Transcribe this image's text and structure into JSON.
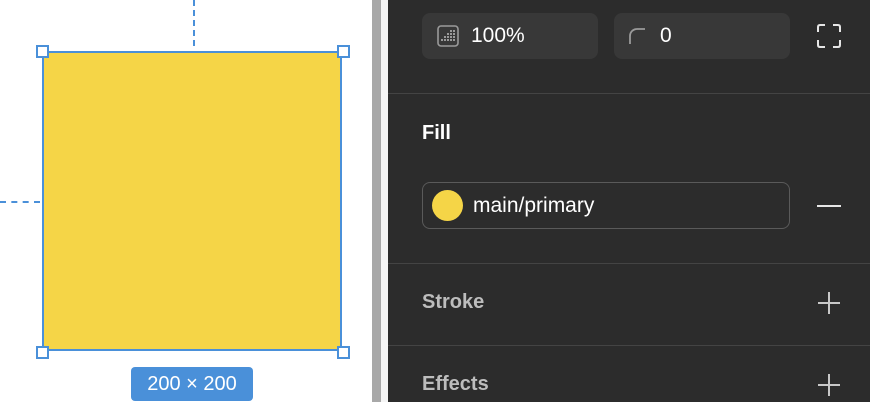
{
  "colors": {
    "selection": "#4a90d9",
    "shape_fill": "#f5d547",
    "panel_bg": "#2c2c2c",
    "field_bg": "#383838"
  },
  "canvas": {
    "size_label": "200 × 200"
  },
  "properties": {
    "opacity": {
      "icon": "opacity-icon",
      "value": "100%"
    },
    "corner_radius": {
      "icon": "corner-radius-icon",
      "value": "0"
    },
    "expand_icon": "expand-corners-icon"
  },
  "fill": {
    "title": "Fill",
    "items": [
      {
        "swatch_color": "#f5d547",
        "name": "main/primary",
        "remove_icon": "minus-icon"
      }
    ]
  },
  "stroke": {
    "title": "Stroke",
    "add_icon": "plus-icon"
  },
  "effects": {
    "title": "Effects",
    "add_icon": "plus-icon"
  }
}
